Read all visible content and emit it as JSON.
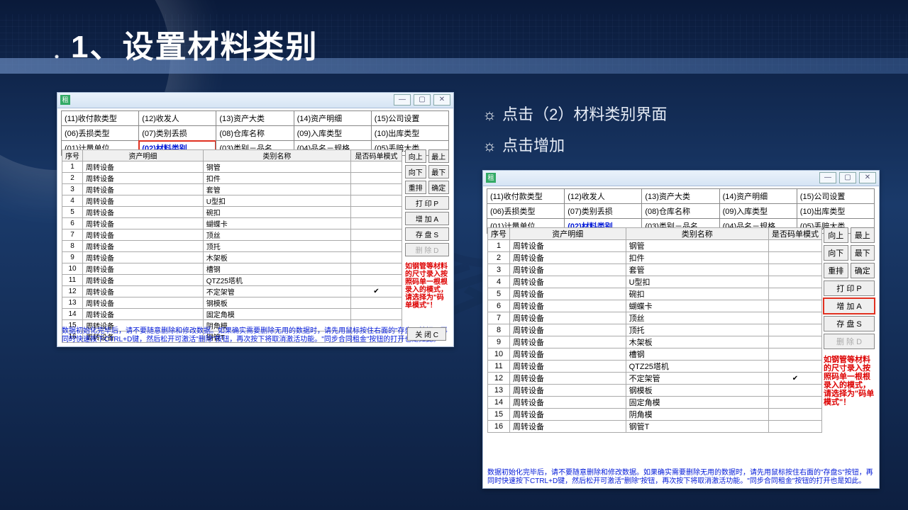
{
  "watermark": "非会员",
  "slide": {
    "title": "1、设置材料类别"
  },
  "bullets": [
    "点击（2）材料类别界面",
    "点击增加"
  ],
  "tabs": {
    "row1": [
      "(11)收付款类型",
      "(12)收发人",
      "(13)资产大类",
      "(14)资产明细",
      "(15)公司设置"
    ],
    "row2": [
      "(06)丢损类型",
      "(07)类别丢损",
      "(08)仓库名称",
      "(09)入库类型",
      "(10)出库类型"
    ],
    "row3": [
      "(01)计量单位",
      "(02)材料类别",
      "(03)类别－品名",
      "(04)品名－规格",
      "(05)丢赔大类"
    ],
    "active": "(02)材料类别"
  },
  "columns": [
    "序号",
    "资产明细",
    "类别名称",
    "是否码单模式"
  ],
  "rows": [
    {
      "n": 1,
      "a": "周转设备",
      "b": "钢管",
      "c": false
    },
    {
      "n": 2,
      "a": "周转设备",
      "b": "扣件",
      "c": false
    },
    {
      "n": 3,
      "a": "周转设备",
      "b": "套管",
      "c": false
    },
    {
      "n": 4,
      "a": "周转设备",
      "b": "U型扣",
      "c": false
    },
    {
      "n": 5,
      "a": "周转设备",
      "b": "碗扣",
      "c": false
    },
    {
      "n": 6,
      "a": "周转设备",
      "b": "蝴蝶卡",
      "c": false
    },
    {
      "n": 7,
      "a": "周转设备",
      "b": "顶丝",
      "c": false
    },
    {
      "n": 8,
      "a": "周转设备",
      "b": "顶托",
      "c": false
    },
    {
      "n": 9,
      "a": "周转设备",
      "b": "木架板",
      "c": false
    },
    {
      "n": 10,
      "a": "周转设备",
      "b": "槽钢",
      "c": false
    },
    {
      "n": 11,
      "a": "周转设备",
      "b": "QTZ25塔机",
      "c": false
    },
    {
      "n": 12,
      "a": "周转设备",
      "b": "不定架管",
      "c": true
    },
    {
      "n": 13,
      "a": "周转设备",
      "b": "钢模板",
      "c": false
    },
    {
      "n": 14,
      "a": "周转设备",
      "b": "固定角模",
      "c": false
    },
    {
      "n": 15,
      "a": "周转设备",
      "b": "阴角模",
      "c": false
    },
    {
      "n": 16,
      "a": "周转设备",
      "b": "钢管T",
      "c": false
    }
  ],
  "sidebtns": {
    "pair1": [
      "向上",
      "最上"
    ],
    "pair2": [
      "向下",
      "最下"
    ],
    "pair3": [
      "重排",
      "确定"
    ],
    "print": "打 印 P",
    "add": "增 加 A",
    "save": "存 盘 S",
    "del": "删 除 D"
  },
  "redhint": "如钢管等材料的尺寸录入按照码单一根根录入的模式，请选择为\"码单模式\"！",
  "footer": "数据初始化完毕后，请不要随意删除和修改数据。如果确实需要删除无用的数据时，请先用鼠标按住右面的\"存盘S\"按钮，再同时快速按下CTRL+D键，然后松开可激活\"删除\"按钮，再次按下将取消激活功能。\"同步合同租金\"按钮的打开也是如此。",
  "closebtn": "关 闭 C",
  "ico": "租"
}
